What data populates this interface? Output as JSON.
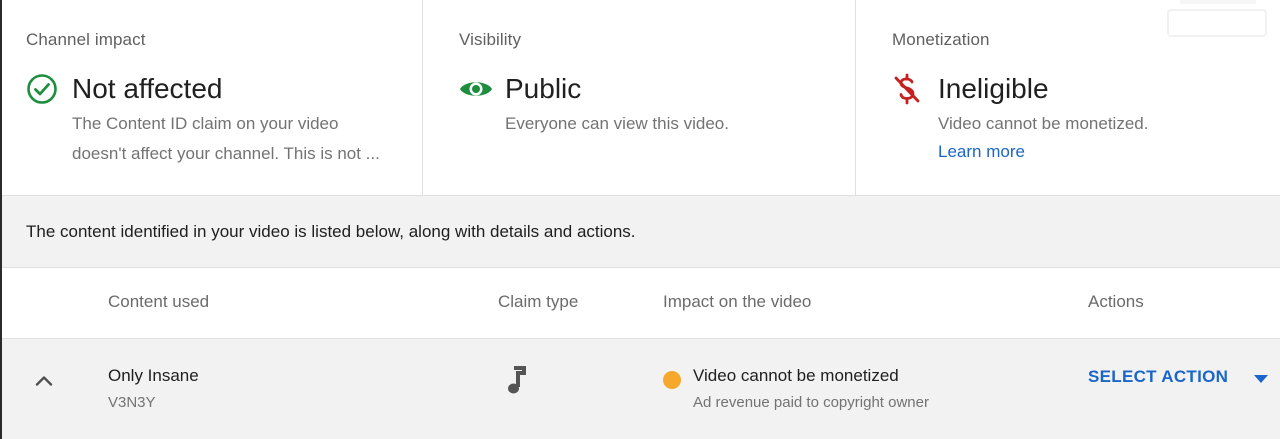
{
  "colors": {
    "success": "#1e8e3e",
    "danger": "#c5221f",
    "link": "#1a66c9",
    "warning_dot": "#f7a82c",
    "banner_bg": "#f2f2f2"
  },
  "cards": [
    {
      "label": "Channel impact",
      "icon": "check-circle-icon",
      "status": "Not affected",
      "description_line1": "The Content ID claim on your video",
      "description_line2": "doesn't affect your channel. This is not ..."
    },
    {
      "label": "Visibility",
      "icon": "eye-icon",
      "status": "Public",
      "description_line1": "Everyone can view this video."
    },
    {
      "label": "Monetization",
      "icon": "no-money-icon",
      "status": "Ineligible",
      "description_line1": "Video cannot be monetized.",
      "link": "Learn more"
    }
  ],
  "banner": "The content identified in your video is listed below, along with details and actions.",
  "table": {
    "headers": {
      "content": "Content used",
      "claim_type": "Claim type",
      "impact": "Impact on the video",
      "actions": "Actions"
    },
    "rows": [
      {
        "content_title": "Only Insane",
        "content_artist": "V3N3Y",
        "claim_type_icon": "music-note-icon",
        "impact_title": "Video cannot be monetized",
        "impact_sub": "Ad revenue paid to copyright owner",
        "action_label": "SELECT ACTION"
      }
    ]
  }
}
